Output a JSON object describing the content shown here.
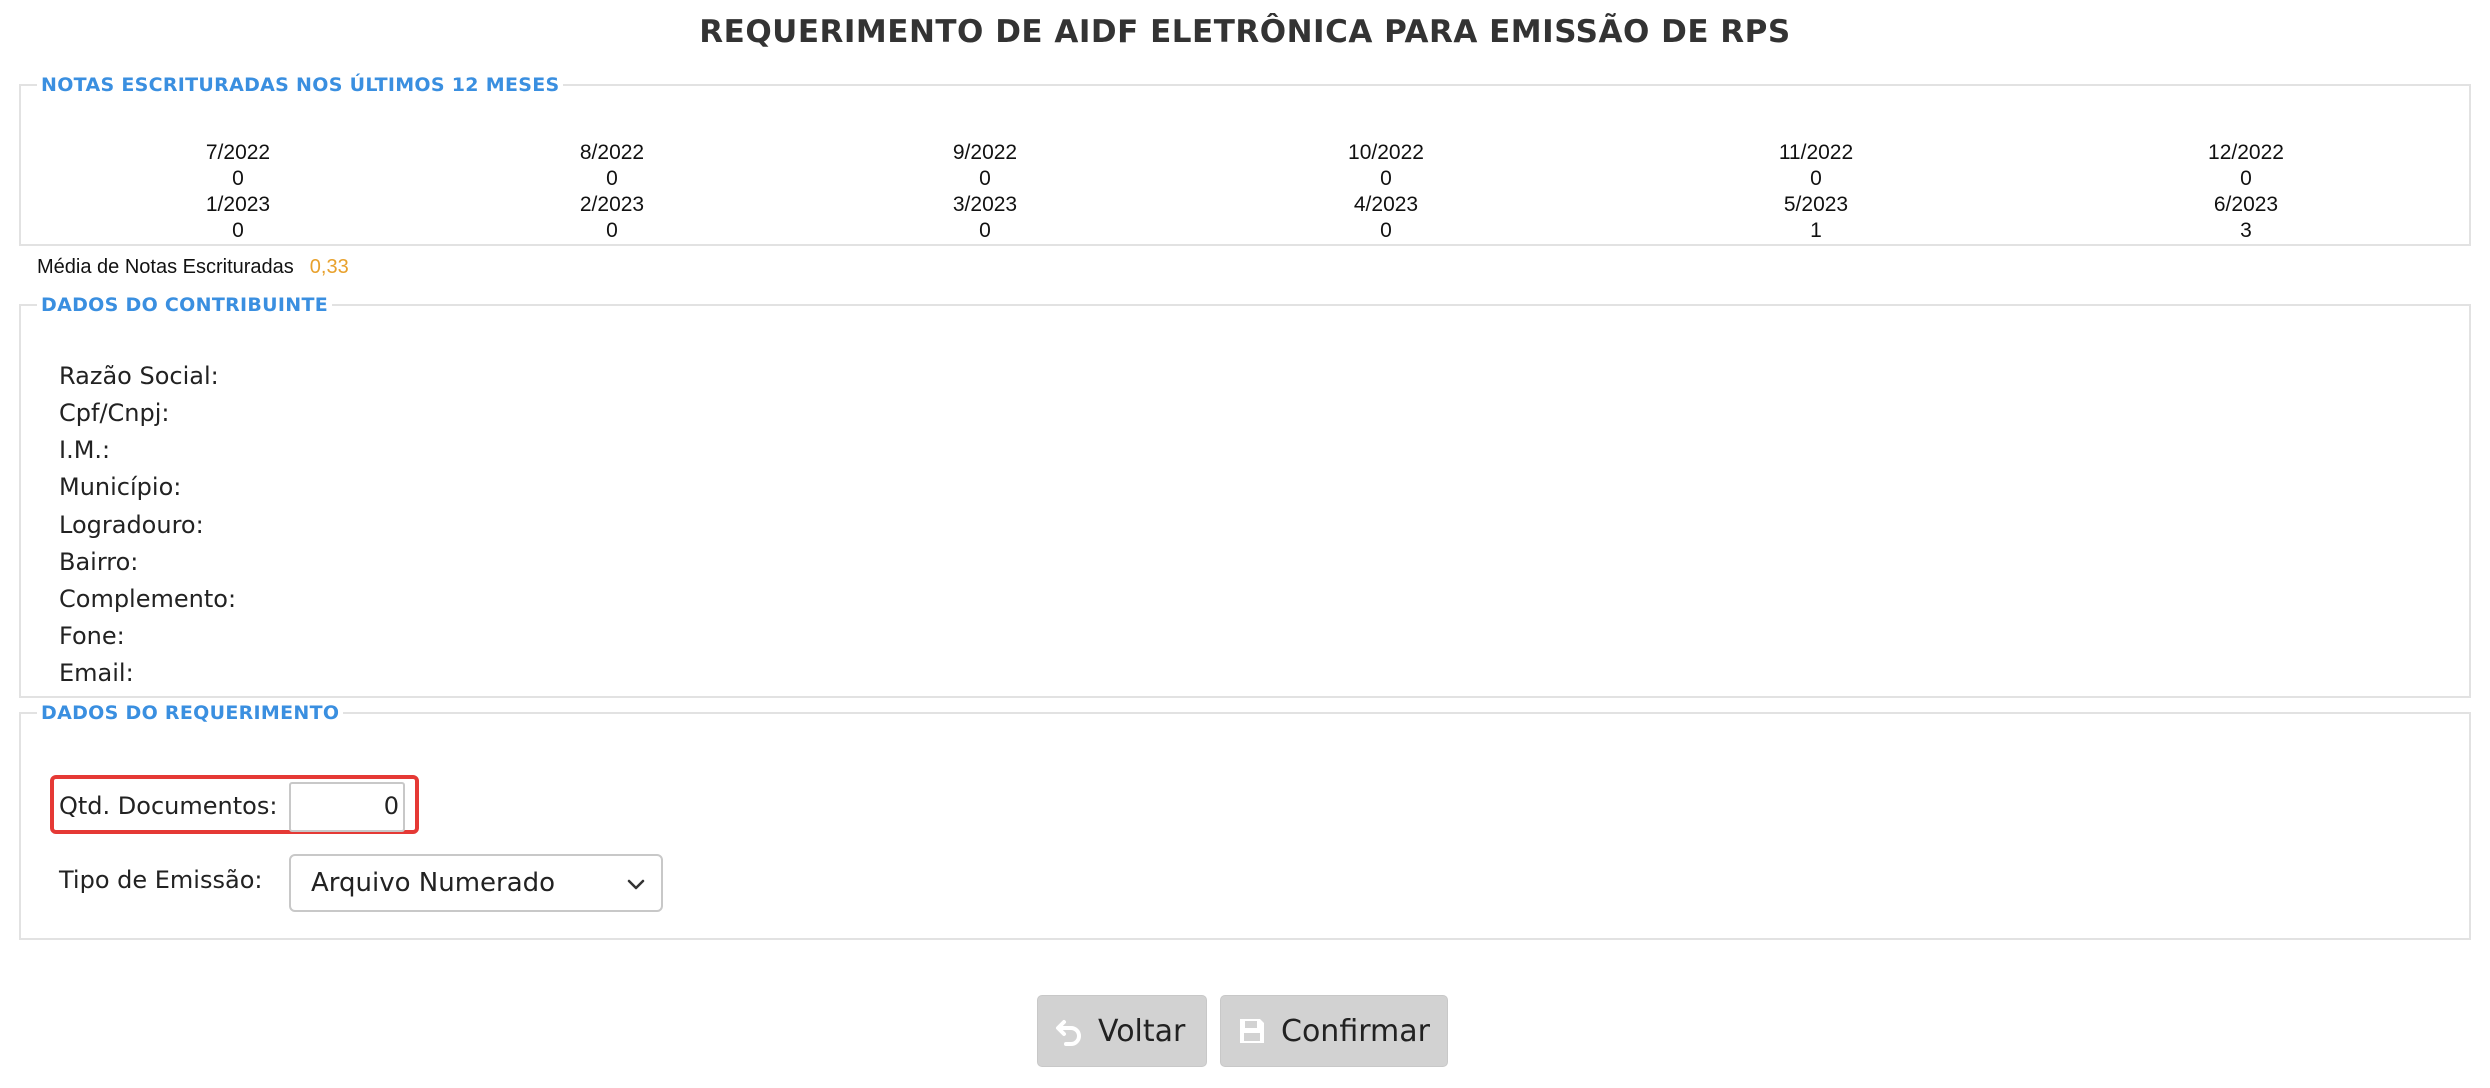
{
  "title": "REQUERIMENTO DE AIDF ELETRÔNICA PARA EMISSÃO DE RPS",
  "notas": {
    "legend": "NOTAS ESCRITURADAS NOS ÚLTIMOS 12 MESES",
    "months": [
      {
        "label": "7/2022",
        "value": "0"
      },
      {
        "label": "8/2022",
        "value": "0"
      },
      {
        "label": "9/2022",
        "value": "0"
      },
      {
        "label": "10/2022",
        "value": "0"
      },
      {
        "label": "11/2022",
        "value": "0"
      },
      {
        "label": "12/2022",
        "value": "0"
      },
      {
        "label": "1/2023",
        "value": "0"
      },
      {
        "label": "2/2023",
        "value": "0"
      },
      {
        "label": "3/2023",
        "value": "0"
      },
      {
        "label": "4/2023",
        "value": "0"
      },
      {
        "label": "5/2023",
        "value": "1"
      },
      {
        "label": "6/2023",
        "value": "3"
      }
    ],
    "media_label": "Média de Notas Escrituradas",
    "media_value": "0,33"
  },
  "contribuinte": {
    "legend": "DADOS DO CONTRIBUINTE",
    "fields": [
      {
        "label": "Razão Social:"
      },
      {
        "label": "Cpf/Cnpj:"
      },
      {
        "label": "I.M.:"
      },
      {
        "label": "Município:"
      },
      {
        "label": "Logradouro:"
      },
      {
        "label": "Bairro:"
      },
      {
        "label": "Complemento:"
      },
      {
        "label": "Fone:"
      },
      {
        "label": "Email:"
      }
    ]
  },
  "requerimento": {
    "legend": "DADOS DO REQUERIMENTO",
    "qtd_label": "Qtd. Documentos:",
    "qtd_value": "0",
    "tipo_label": "Tipo de Emissão:",
    "tipo_selected": "Arquivo Numerado"
  },
  "buttons": {
    "voltar": "Voltar",
    "confirmar": "Confirmar"
  },
  "colors": {
    "legend": "#3a8fe0",
    "media_value": "#e8a12c",
    "highlight": "#e53935",
    "button_bg": "#d2d2d2"
  },
  "icons": {
    "voltar": "undo-icon",
    "confirmar": "save-icon",
    "select": "chevron-down-icon"
  }
}
